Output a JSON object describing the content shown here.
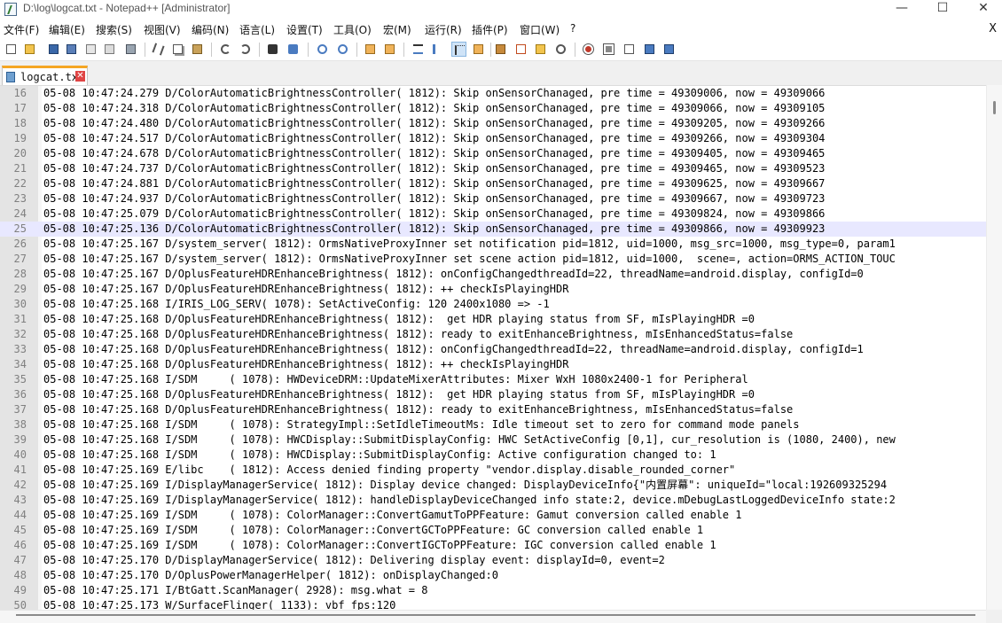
{
  "window": {
    "title": "D:\\log\\logcat.txt - Notepad++ [Administrator]",
    "minimize_glyph": "—",
    "maximize_glyph": "☐",
    "close_glyph": "✕"
  },
  "menu": {
    "items": [
      "文件(F)",
      "编辑(E)",
      "搜索(S)",
      "视图(V)",
      "编码(N)",
      "语言(L)",
      "设置(T)",
      "工具(O)",
      "宏(M)",
      "运行(R)",
      "插件(P)",
      "窗口(W)",
      "?"
    ],
    "close_label": "X"
  },
  "toolbar": {
    "icons": [
      "new-file-icon",
      "open-file-icon",
      "save-icon",
      "save-all-icon",
      "close-icon",
      "close-all-icon",
      "print-icon",
      "cut-icon",
      "copy-icon",
      "paste-icon",
      "undo-icon",
      "redo-icon",
      "find-icon",
      "replace-icon",
      "zoom-in-icon",
      "zoom-out-icon",
      "sync-vertical-icon",
      "sync-horizontal-icon",
      "word-wrap-icon",
      "show-all-chars-icon",
      "indent-guide-icon",
      "language-icon",
      "doc-map-icon",
      "function-list-icon",
      "folder-workspace-icon",
      "monitoring-icon",
      "record-macro-icon",
      "stop-macro-icon",
      "play-macro-icon",
      "run-macro-multiple-icon",
      "save-macro-icon"
    ]
  },
  "tabs": [
    {
      "label": "logcat.txt",
      "active": true
    }
  ],
  "editor": {
    "current_line": 25,
    "lines": [
      {
        "n": "16",
        "text": "05-08 10:47:24.279 D/ColorAutomaticBrightnessController( 1812): Skip onSensorChanaged, pre time = 49309006, now = 49309066"
      },
      {
        "n": "17",
        "text": "05-08 10:47:24.318 D/ColorAutomaticBrightnessController( 1812): Skip onSensorChanaged, pre time = 49309066, now = 49309105"
      },
      {
        "n": "18",
        "text": "05-08 10:47:24.480 D/ColorAutomaticBrightnessController( 1812): Skip onSensorChanaged, pre time = 49309205, now = 49309266"
      },
      {
        "n": "19",
        "text": "05-08 10:47:24.517 D/ColorAutomaticBrightnessController( 1812): Skip onSensorChanaged, pre time = 49309266, now = 49309304"
      },
      {
        "n": "20",
        "text": "05-08 10:47:24.678 D/ColorAutomaticBrightnessController( 1812): Skip onSensorChanaged, pre time = 49309405, now = 49309465"
      },
      {
        "n": "21",
        "text": "05-08 10:47:24.737 D/ColorAutomaticBrightnessController( 1812): Skip onSensorChanaged, pre time = 49309465, now = 49309523"
      },
      {
        "n": "22",
        "text": "05-08 10:47:24.881 D/ColorAutomaticBrightnessController( 1812): Skip onSensorChanaged, pre time = 49309625, now = 49309667"
      },
      {
        "n": "23",
        "text": "05-08 10:47:24.937 D/ColorAutomaticBrightnessController( 1812): Skip onSensorChanaged, pre time = 49309667, now = 49309723"
      },
      {
        "n": "24",
        "text": "05-08 10:47:25.079 D/ColorAutomaticBrightnessController( 1812): Skip onSensorChanaged, pre time = 49309824, now = 49309866"
      },
      {
        "n": "25",
        "text": "05-08 10:47:25.136 D/ColorAutomaticBrightnessController( 1812): Skip onSensorChanaged, pre time = 49309866, now = 49309923"
      },
      {
        "n": "26",
        "text": "05-08 10:47:25.167 D/system_server( 1812): OrmsNativeProxyInner set notification pid=1812, uid=1000, msg_src=1000, msg_type=0, param1"
      },
      {
        "n": "27",
        "text": "05-08 10:47:25.167 D/system_server( 1812): OrmsNativeProxyInner set scene action pid=1812, uid=1000,  scene=, action=ORMS_ACTION_TOUC"
      },
      {
        "n": "28",
        "text": "05-08 10:47:25.167 D/OplusFeatureHDREnhanceBrightness( 1812): onConfigChangedthreadId=22, threadName=android.display, configId=0"
      },
      {
        "n": "29",
        "text": "05-08 10:47:25.167 D/OplusFeatureHDREnhanceBrightness( 1812): ++ checkIsPlayingHDR"
      },
      {
        "n": "30",
        "text": "05-08 10:47:25.168 I/IRIS_LOG_SERV( 1078): SetActiveConfig: 120 2400x1080 => -1"
      },
      {
        "n": "31",
        "text": "05-08 10:47:25.168 D/OplusFeatureHDREnhanceBrightness( 1812):  get HDR playing status from SF, mIsPlayingHDR =0"
      },
      {
        "n": "32",
        "text": "05-08 10:47:25.168 D/OplusFeatureHDREnhanceBrightness( 1812): ready to exitEnhanceBrightness, mIsEnhancedStatus=false"
      },
      {
        "n": "33",
        "text": "05-08 10:47:25.168 D/OplusFeatureHDREnhanceBrightness( 1812): onConfigChangedthreadId=22, threadName=android.display, configId=1"
      },
      {
        "n": "34",
        "text": "05-08 10:47:25.168 D/OplusFeatureHDREnhanceBrightness( 1812): ++ checkIsPlayingHDR"
      },
      {
        "n": "35",
        "text": "05-08 10:47:25.168 I/SDM     ( 1078): HWDeviceDRM::UpdateMixerAttributes: Mixer WxH 1080x2400-1 for Peripheral"
      },
      {
        "n": "36",
        "text": "05-08 10:47:25.168 D/OplusFeatureHDREnhanceBrightness( 1812):  get HDR playing status from SF, mIsPlayingHDR =0"
      },
      {
        "n": "37",
        "text": "05-08 10:47:25.168 D/OplusFeatureHDREnhanceBrightness( 1812): ready to exitEnhanceBrightness, mIsEnhancedStatus=false"
      },
      {
        "n": "38",
        "text": "05-08 10:47:25.168 I/SDM     ( 1078): StrategyImpl::SetIdleTimeoutMs: Idle timeout set to zero for command mode panels"
      },
      {
        "n": "39",
        "text": "05-08 10:47:25.168 I/SDM     ( 1078): HWCDisplay::SubmitDisplayConfig: HWC SetActiveConfig [0,1], cur_resolution is (1080, 2400), new"
      },
      {
        "n": "40",
        "text": "05-08 10:47:25.168 I/SDM     ( 1078): HWCDisplay::SubmitDisplayConfig: Active configuration changed to: 1"
      },
      {
        "n": "41",
        "text": "05-08 10:47:25.169 E/libc    ( 1812): Access denied finding property \"vendor.display.disable_rounded_corner\""
      },
      {
        "n": "42",
        "text": "05-08 10:47:25.169 I/DisplayManagerService( 1812): Display device changed: DisplayDeviceInfo{\"内置屏幕\": uniqueId=\"local:192609325294"
      },
      {
        "n": "43",
        "text": "05-08 10:47:25.169 I/DisplayManagerService( 1812): handleDisplayDeviceChanged info state:2, device.mDebugLastLoggedDeviceInfo state:2"
      },
      {
        "n": "44",
        "text": "05-08 10:47:25.169 I/SDM     ( 1078): ColorManager::ConvertGamutToPPFeature: Gamut conversion called enable 1"
      },
      {
        "n": "45",
        "text": "05-08 10:47:25.169 I/SDM     ( 1078): ColorManager::ConvertGCToPPFeature: GC conversion called enable 1"
      },
      {
        "n": "46",
        "text": "05-08 10:47:25.169 I/SDM     ( 1078): ColorManager::ConvertIGCToPPFeature: IGC conversion called enable 1"
      },
      {
        "n": "47",
        "text": "05-08 10:47:25.170 D/DisplayManagerService( 1812): Delivering display event: displayId=0, event=2"
      },
      {
        "n": "48",
        "text": "05-08 10:47:25.170 D/OplusPowerManagerHelper( 1812): onDisplayChanged:0"
      },
      {
        "n": "49",
        "text": "05-08 10:47:25.171 I/BtGatt.ScanManager( 2928): msg.what = 8"
      },
      {
        "n": "50",
        "text": "05-08 10:47:25.173 W/SurfaceFlinger( 1133): vbf fps:120"
      }
    ]
  }
}
